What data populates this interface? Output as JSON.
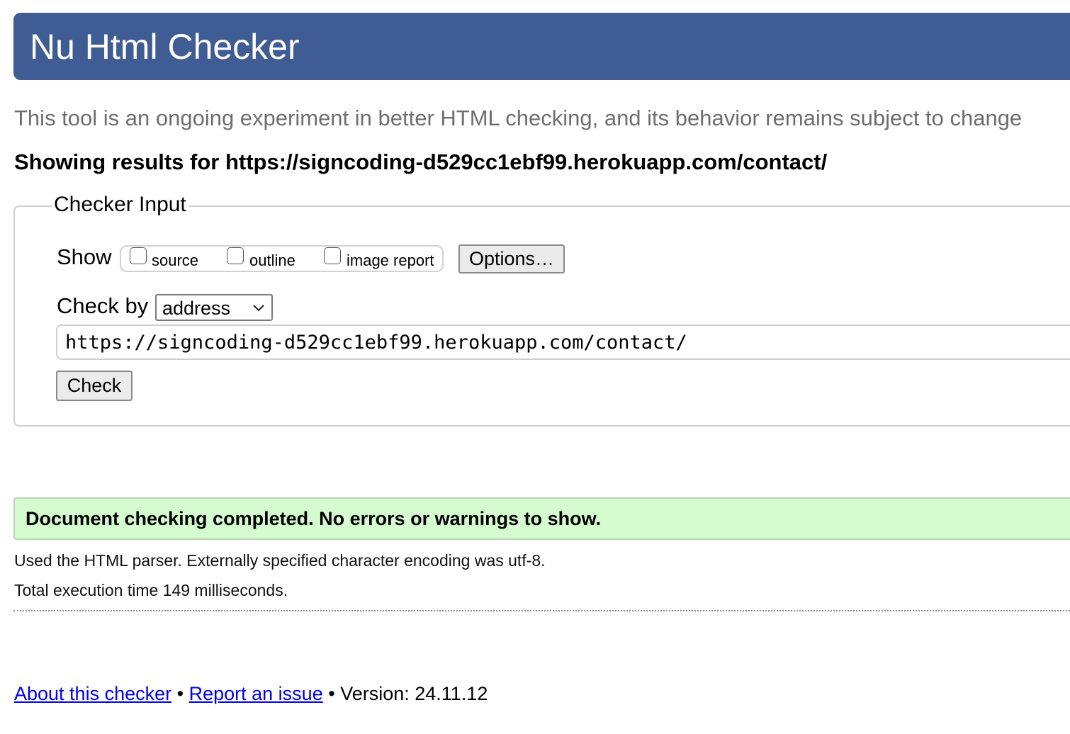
{
  "header": {
    "title": "Nu Html Checker"
  },
  "tagline": "This tool is an ongoing experiment in better HTML checking, and its behavior remains subject to change",
  "results_heading": "Showing results for https://signcoding-d529cc1ebf99.herokuapp.com/contact/",
  "checker_input": {
    "legend": "Checker Input",
    "show_label": "Show",
    "checkboxes": [
      {
        "label": "source",
        "checked": false
      },
      {
        "label": "outline",
        "checked": false
      },
      {
        "label": "image report",
        "checked": false
      }
    ],
    "options_button": "Options…",
    "check_by_label": "Check by",
    "check_by_value": "address",
    "url_value": "https://signcoding-d529cc1ebf99.herokuapp.com/contact/",
    "check_button": "Check"
  },
  "result": {
    "message": "Document checking completed. No errors or warnings to show.",
    "parser_info": "Used the HTML parser. Externally specified character encoding was utf-8.",
    "execution_time": "Total execution time 149 milliseconds."
  },
  "footer": {
    "about_link": "About this checker",
    "separator": "•",
    "report_link": "Report an issue",
    "version": "Version: 24.11.12"
  },
  "colors": {
    "header_bg": "#3f5d94",
    "success_bg": "#d5fccf",
    "tagline": "#6e6e6e",
    "link": "#0000ee"
  }
}
